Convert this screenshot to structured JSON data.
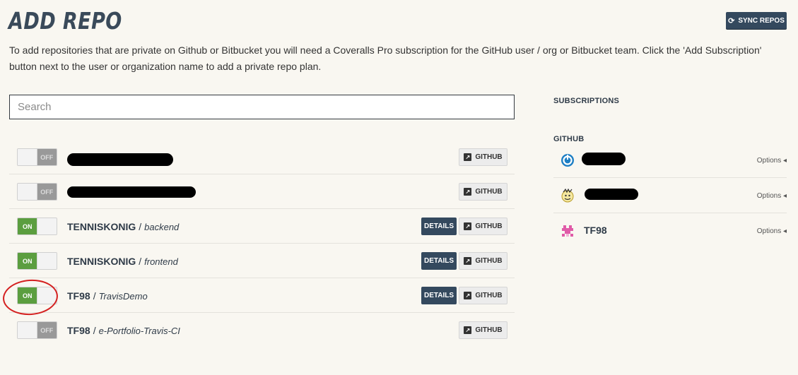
{
  "page": {
    "title": "ADD REPO",
    "sync_button": "SYNC REPOS",
    "intro": "To add repositories that are private on Github or Bitbucket you will need a Coveralls Pro subscription for the GitHub user / org or Bitbucket team. Click the 'Add Subscription' button next to the user or organization name to add a private repo plan."
  },
  "search": {
    "placeholder": "Search",
    "value": ""
  },
  "repos": [
    {
      "owner": "",
      "repo": "",
      "state": "OFF",
      "details": false,
      "redacted": true
    },
    {
      "owner": "",
      "repo": "",
      "state": "OFF",
      "details": false,
      "redacted": true
    },
    {
      "owner": "TENNISKONIG",
      "repo": "backend",
      "state": "ON",
      "details": true,
      "redacted": false
    },
    {
      "owner": "TENNISKONIG",
      "repo": "frontend",
      "state": "ON",
      "details": true,
      "redacted": false
    },
    {
      "owner": "TF98",
      "repo": "TravisDemo",
      "state": "ON",
      "details": true,
      "redacted": false
    },
    {
      "owner": "TF98",
      "repo": "e-Portfolio-Travis-CI",
      "state": "OFF",
      "details": false,
      "redacted": false
    }
  ],
  "buttons": {
    "details": "DETAILS",
    "github": "GITHUB",
    "slash": "/"
  },
  "subscriptions": {
    "heading": "SUBSCRIPTIONS",
    "github_heading": "GITHUB",
    "options_label": "Options ◂",
    "items": [
      {
        "name": "",
        "redacted": true
      },
      {
        "name": "",
        "redacted": true
      },
      {
        "name": "TF98",
        "redacted": false
      }
    ]
  },
  "colors": {
    "on": "#5b9e3f",
    "off": "#999999",
    "navy": "#34495e",
    "annotation": "#d42020"
  }
}
